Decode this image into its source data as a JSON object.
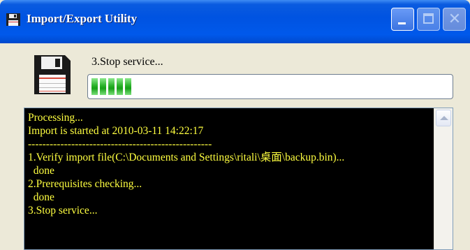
{
  "window": {
    "title": "Import/Export Utility"
  },
  "status": {
    "label": "3.Stop service...",
    "progress_segments": 5
  },
  "console": {
    "lines": [
      "Processing...",
      "Import is started at 2010-03-11 14:22:17",
      "---------------------------------------------------",
      "1.Verify import file(C:\\Documents and Settings\\ritali\\桌面\\backup.bin)...",
      "  done",
      "2.Prerequisites checking...",
      "  done",
      "3.Stop service..."
    ]
  },
  "icons": {
    "title": "floppy-disk-icon",
    "main": "floppy-disk-icon",
    "scroll_up": "scroll-up-arrow-icon"
  },
  "colors": {
    "titlebar": "#0053E1",
    "console_bg": "#000000",
    "console_text": "#FFFF40",
    "progress": "#29B229"
  }
}
